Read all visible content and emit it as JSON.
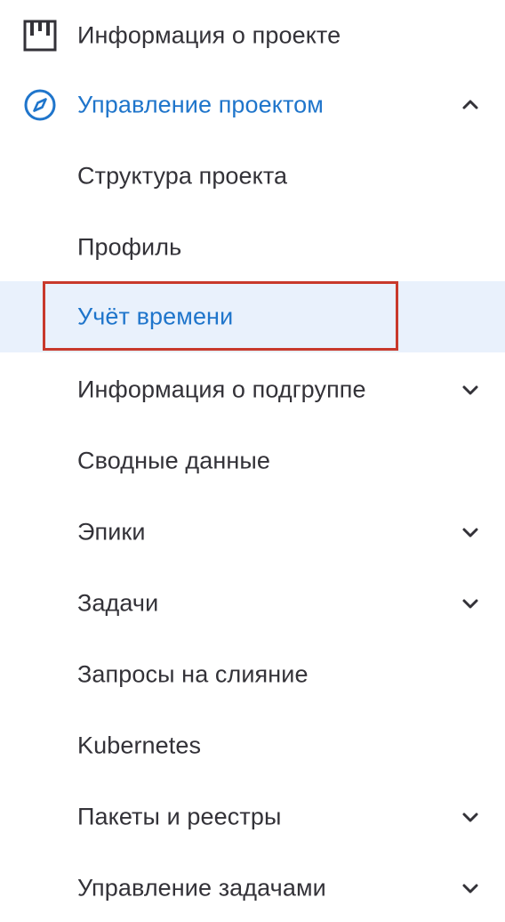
{
  "colors": {
    "text": "#333238",
    "accent": "#1f75cb",
    "selected_bg": "#e9f1fc",
    "highlight_border": "#c8392b"
  },
  "nav": {
    "project_info": {
      "label": "Информация о проекте",
      "icon": "board-icon"
    },
    "project_management": {
      "label": "Управление проектом",
      "icon": "compass-icon",
      "expanded": true
    },
    "items": [
      {
        "label": "Структура проекта",
        "has_chevron": false
      },
      {
        "label": "Профиль",
        "has_chevron": false
      },
      {
        "label": "Учёт времени",
        "has_chevron": false,
        "selected": true
      },
      {
        "label": "Информация о подгруппе",
        "has_chevron": true
      },
      {
        "label": "Сводные данные",
        "has_chevron": false
      },
      {
        "label": "Эпики",
        "has_chevron": true
      },
      {
        "label": "Задачи",
        "has_chevron": true
      },
      {
        "label": "Запросы на слияние",
        "has_chevron": false
      },
      {
        "label": "Kubernetes",
        "has_chevron": false
      },
      {
        "label": "Пакеты и реестры",
        "has_chevron": true
      },
      {
        "label": "Управление задачами",
        "has_chevron": true
      }
    ]
  }
}
